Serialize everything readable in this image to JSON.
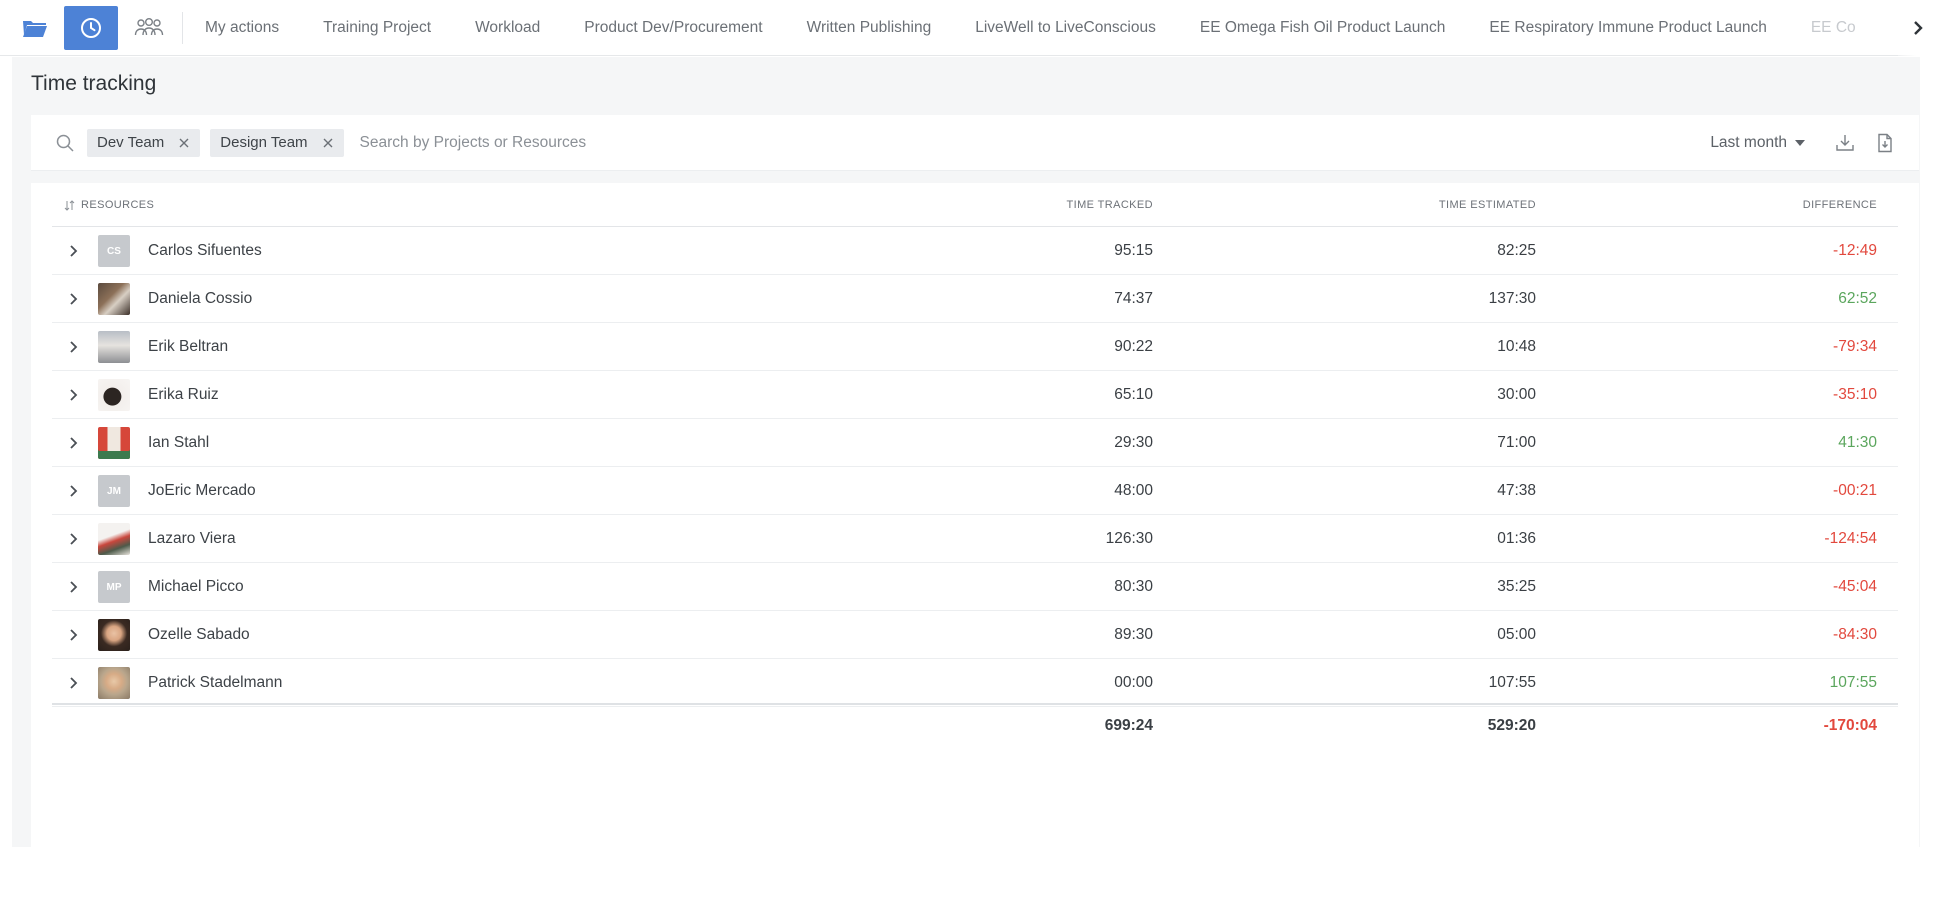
{
  "topbar": {
    "tabs": [
      "My actions",
      "Training Project",
      "Workload",
      "Product Dev/Procurement",
      "Written Publishing",
      "LiveWell to LiveConscious",
      "EE Omega Fish Oil Product Launch",
      "EE Respiratory Immune Product Launch",
      "EE Co"
    ],
    "accent": "#4d82d6"
  },
  "page": {
    "title": "Time tracking"
  },
  "filters": {
    "chips": [
      "Dev Team",
      "Design Team"
    ],
    "search_placeholder": "Search by Projects or Resources",
    "period": "Last month"
  },
  "table": {
    "headers": {
      "resources": "RESOURCES",
      "tracked": "TIME TRACKED",
      "estimated": "TIME ESTIMATED",
      "difference": "DIFFERENCE"
    },
    "rows": [
      {
        "name": "Carlos Sifuentes",
        "initials": "CS",
        "tracked": "95:15",
        "estimated": "82:25",
        "difference": "-12:49",
        "sign": "neg"
      },
      {
        "name": "Daniela Cossio",
        "initials": "",
        "tracked": "74:37",
        "estimated": "137:30",
        "difference": "62:52",
        "sign": "pos"
      },
      {
        "name": "Erik Beltran",
        "initials": "",
        "tracked": "90:22",
        "estimated": "10:48",
        "difference": "-79:34",
        "sign": "neg"
      },
      {
        "name": "Erika Ruiz",
        "initials": "",
        "tracked": "65:10",
        "estimated": "30:00",
        "difference": "-35:10",
        "sign": "neg"
      },
      {
        "name": "Ian Stahl",
        "initials": "",
        "tracked": "29:30",
        "estimated": "71:00",
        "difference": "41:30",
        "sign": "pos"
      },
      {
        "name": "JoEric Mercado",
        "initials": "JM",
        "tracked": "48:00",
        "estimated": "47:38",
        "difference": "-00:21",
        "sign": "neg"
      },
      {
        "name": "Lazaro Viera",
        "initials": "",
        "tracked": "126:30",
        "estimated": "01:36",
        "difference": "-124:54",
        "sign": "neg"
      },
      {
        "name": "Michael Picco",
        "initials": "MP",
        "tracked": "80:30",
        "estimated": "35:25",
        "difference": "-45:04",
        "sign": "neg"
      },
      {
        "name": "Ozelle Sabado",
        "initials": "",
        "tracked": "89:30",
        "estimated": "05:00",
        "difference": "-84:30",
        "sign": "neg"
      },
      {
        "name": "Patrick Stadelmann",
        "initials": "",
        "tracked": "00:00",
        "estimated": "107:55",
        "difference": "107:55",
        "sign": "pos"
      }
    ],
    "totals": {
      "tracked": "699:24",
      "estimated": "529:20",
      "difference": "-170:04",
      "sign": "neg"
    }
  },
  "colors": {
    "negative": "#e2483d",
    "positive": "#5ba65d"
  }
}
